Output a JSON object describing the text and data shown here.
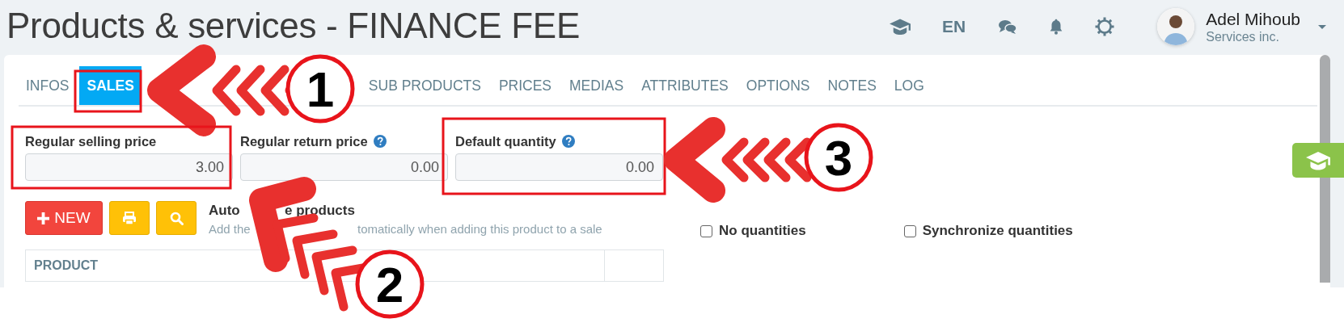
{
  "header": {
    "title": "Products & services - FINANCE FEE",
    "language": "EN",
    "user": {
      "name": "Adel Mihoub",
      "company": "Services inc."
    }
  },
  "tabs": [
    {
      "label": "INFOS",
      "selected": false
    },
    {
      "label": "SALES",
      "selected": true
    },
    {
      "label": "SUB PRODUCTS",
      "selected": false
    },
    {
      "label": "PRICES",
      "selected": false
    },
    {
      "label": "MEDIAS",
      "selected": false
    },
    {
      "label": "ATTRIBUTES",
      "selected": false
    },
    {
      "label": "OPTIONS",
      "selected": false
    },
    {
      "label": "NOTES",
      "selected": false
    },
    {
      "label": "LOG",
      "selected": false
    }
  ],
  "fields": [
    {
      "label": "Regular selling price",
      "help": false,
      "value": "3.00"
    },
    {
      "label": "Regular return price",
      "help": true,
      "value": "0.00"
    },
    {
      "label": "Default quantity",
      "help": true,
      "value": "0.00"
    }
  ],
  "buttons": [
    {
      "kind": "new",
      "label": "NEW"
    },
    {
      "kind": "print"
    },
    {
      "kind": "search"
    }
  ],
  "automatic_products": {
    "title_parts": [
      "Auto",
      "e products"
    ],
    "hint_parts": [
      "Add the",
      "tomatically when adding this product to a sale"
    ]
  },
  "options": [
    {
      "label": "No quantities",
      "checked": false
    },
    {
      "label": "Synchronize quantities",
      "checked": false
    }
  ],
  "table": {
    "columns": [
      "PRODUCT"
    ]
  },
  "annotations": [
    {
      "number": "1"
    },
    {
      "number": "2"
    },
    {
      "number": "3"
    }
  ]
}
